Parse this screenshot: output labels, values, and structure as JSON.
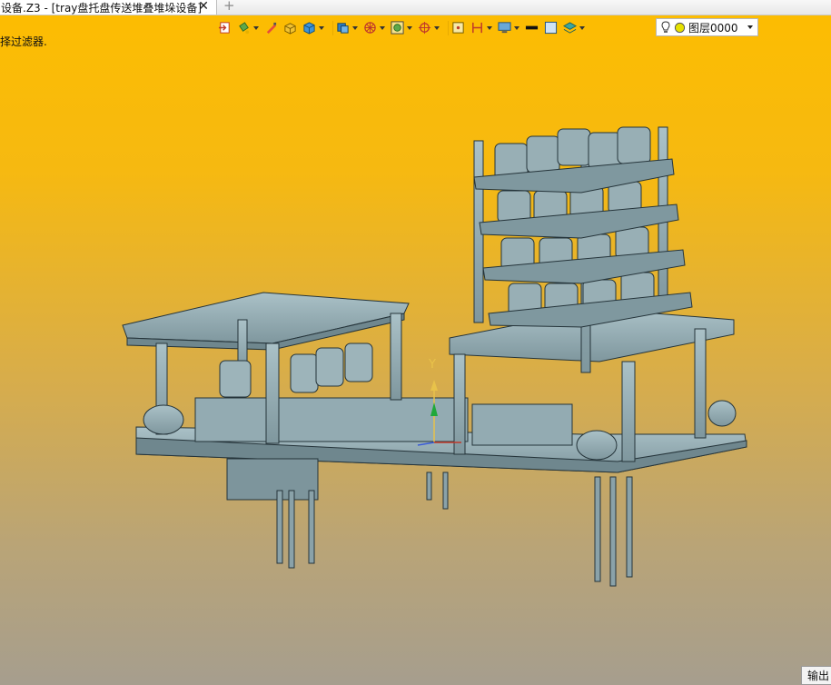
{
  "tab": {
    "title": "设备.Z3 - [tray盘托盘传送堆叠堆垛设备]",
    "close": "✕",
    "new_tab": "+"
  },
  "status_hint": "择过滤器.",
  "toolbar": {
    "icons": [
      "export-icon",
      "paint-bucket-icon",
      "pen-icon",
      "box-yellow-icon",
      "cube-blue-icon",
      "solid-blue-icon",
      "wheel-icon",
      "frame-icon",
      "target-icon",
      "square-dot-icon",
      "bracket-icon",
      "monitor-icon",
      "line-black-icon",
      "color-square-icon",
      "layers-icon"
    ]
  },
  "layer": {
    "name": "图层0000"
  },
  "axis": {
    "y_label": "Y"
  },
  "output_button": "输出",
  "colors": {
    "accent": "#fdbd00",
    "model": "#8aa5ad",
    "model_dark": "#2f3b40"
  }
}
